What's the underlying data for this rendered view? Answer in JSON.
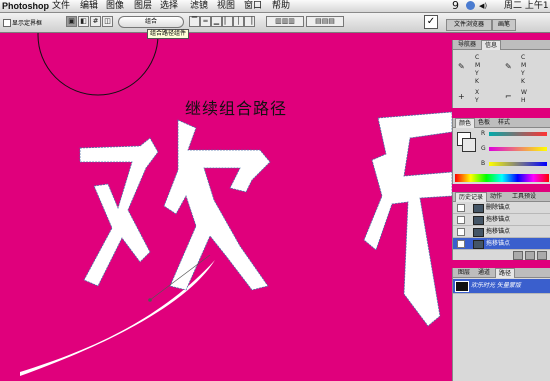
{
  "menubar": {
    "app": "Photoshop",
    "items": [
      "文件",
      "编辑",
      "图像",
      "图层",
      "选择",
      "滤镜",
      "视图",
      "窗口",
      "帮助"
    ],
    "badge": "9",
    "clock": "周二 上午1"
  },
  "options": {
    "show_bbox_label": "显示定界框",
    "combine_button": "组合",
    "tooltip": "组合路径组件",
    "tab_browser": "文件浏览器",
    "tab_brushes": "画笔"
  },
  "annotation": "继续组合路径",
  "navigator": {
    "tabs": [
      "导航器",
      "信息"
    ],
    "cmyk_letters": [
      "C",
      "M",
      "Y",
      "K"
    ],
    "xy_letters": [
      "X",
      "Y"
    ],
    "wh_letters": [
      "W",
      "H"
    ],
    "colon": ":"
  },
  "color_panel": {
    "tabs": [
      "颜色",
      "色板",
      "样式"
    ],
    "channels": [
      "R",
      "G",
      "B"
    ]
  },
  "history": {
    "tabs": [
      "历史记录",
      "动作",
      "工具预设"
    ],
    "rows": [
      "删除锚点",
      "拖移锚点",
      "拖移锚点",
      "拖移锚点"
    ]
  },
  "layers": {
    "tabs": [
      "图层",
      "通道",
      "路径"
    ],
    "row": "欢乐时光 矢量蒙版"
  },
  "colors": {
    "canvas": "#e0007c",
    "accent": "#3a5fcd"
  }
}
